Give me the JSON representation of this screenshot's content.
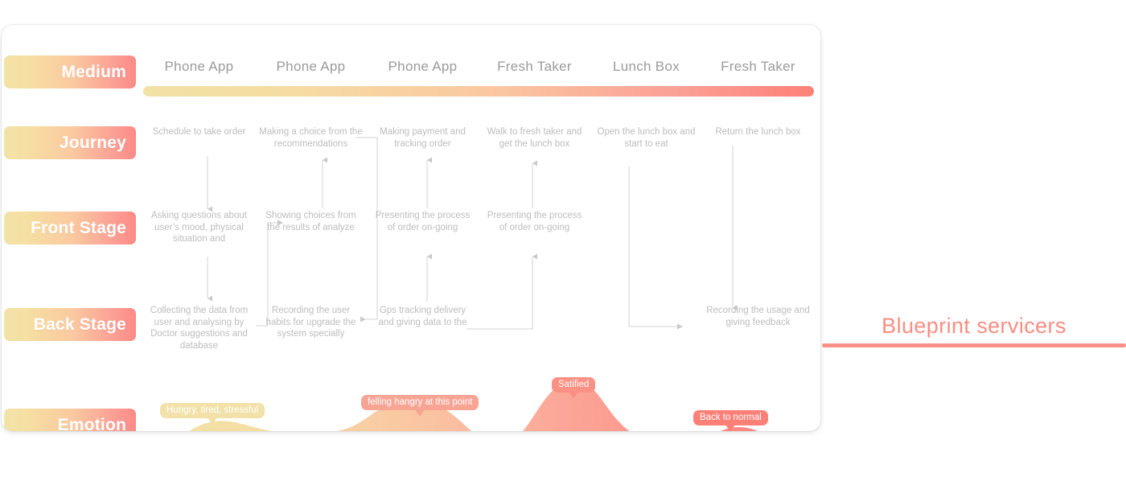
{
  "title": {
    "text": "Blueprint servicers",
    "accent_color": "#fb8d82"
  },
  "rows": {
    "medium": "Medium",
    "journey": "Journey",
    "front_stage": "Front Stage",
    "back_stage": "Back Stage",
    "emotion": "Emotion"
  },
  "medium": {
    "columns": [
      "Phone App",
      "Phone App",
      "Phone App",
      "Fresh Taker",
      "Lunch Box",
      "Fresh Taker"
    ],
    "bar_gradient_from": "#f0e2a4",
    "bar_gradient_to": "#fc8078"
  },
  "journey": [
    "Schedule to take order",
    "Making a choice from the recommendations",
    "Making payment and tracking order",
    "Walk to fresh taker and get the lunch box",
    "Open the lunch box and start to eat",
    "Return the lunch box"
  ],
  "front_stage": [
    "Asking questions about user’s mood, physical situation and",
    "Showing choices from the results of analyze",
    "Presenting the process of order on-going",
    "Presenting the process of order on-going",
    "",
    ""
  ],
  "back_stage": [
    "Collecting the data from user and analysing by Doctor suggestions and database",
    "Recording the user habits for upgrade the system specially",
    "Gps tracking delivery and giving data to the",
    "",
    "",
    "Recording the usage and giving feedback"
  ],
  "emotion": {
    "labels": [
      "Hungry, tired, stressful",
      "felling hangry at this point",
      "Satified",
      "Back to normal"
    ],
    "label_colors": [
      "#f2e2a9",
      "#f8a495",
      "#fb9084",
      "#fd8078"
    ],
    "curve_gradient_from": "#f1e2a6",
    "curve_gradient_to": "#fd7d75"
  },
  "pill_gradient": {
    "from": "#f2e3a8",
    "to": "#fc8a85"
  }
}
